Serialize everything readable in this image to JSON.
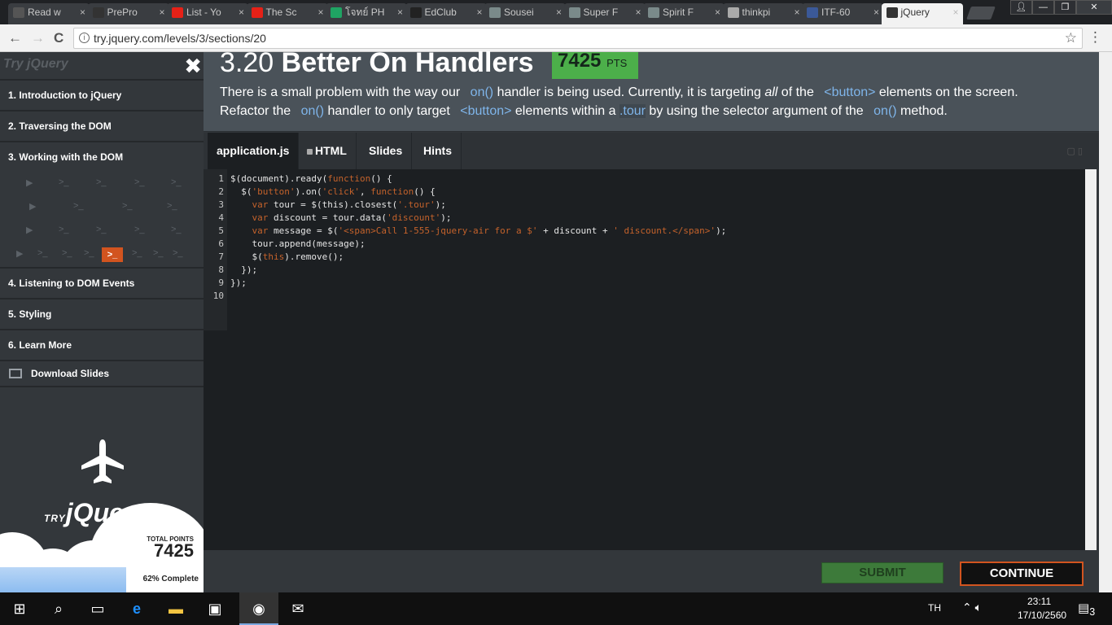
{
  "browser": {
    "tabs": [
      {
        "label": "Read w",
        "color": "#555"
      },
      {
        "label": "PrePro",
        "color": "#333"
      },
      {
        "label": "List - Yo",
        "color": "#e62117"
      },
      {
        "label": "The Sc",
        "color": "#e62117"
      },
      {
        "label": "โจทย์ PH",
        "color": "#1fa463"
      },
      {
        "label": "EdClub",
        "color": "#222"
      },
      {
        "label": "Sousei",
        "color": "#7a8a8a"
      },
      {
        "label": "Super F",
        "color": "#7a8a8a"
      },
      {
        "label": "Spirit F",
        "color": "#7a8a8a"
      },
      {
        "label": "thinkpi",
        "color": "#aaa"
      },
      {
        "label": "ITF-60",
        "color": "#3b5998"
      },
      {
        "label": "jQuery",
        "color": "#333"
      }
    ],
    "tab_close": "×",
    "url": "try.jquery.com/levels/3/sections/20",
    "star": "☆",
    "menu": "⋮",
    "back": "←",
    "forward": "→",
    "reload": "C",
    "info": "i"
  },
  "sidebar": {
    "title": "Try jQuery",
    "close": "✖",
    "sections": [
      "1. Introduction to jQuery",
      "2. Traversing the DOM",
      "3. Working with the DOM",
      "4. Listening to DOM Events",
      "5. Styling",
      "6. Learn More"
    ],
    "download": "Download Slides",
    "logo_try": "TRY",
    "logo_jquery": "jQuery",
    "total_points_label": "TOTAL POINTS",
    "total_points": "7425",
    "progress_text": "62% Complete",
    "progress_fraction": 0.62
  },
  "lesson": {
    "number": "3.20",
    "title": "Better On Handlers",
    "points": "7425",
    "points_unit": "PTS",
    "desc": {
      "p1": "There is a small problem with the way our ",
      "c1": "on()",
      "p2": " handler is being used. Currently, it is targeting ",
      "em": "all",
      "p3": " of the ",
      "c2": "<button>",
      "p4": " elements on the screen.",
      "p5": "Refactor the ",
      "c3": "on()",
      "p6": " handler to only target ",
      "c4": "<button>",
      "p7": " elements within a ",
      "c5": ".tour",
      "p8": " by using the selector argument of the ",
      "c6": "on()",
      "p9": " method."
    }
  },
  "editor": {
    "tabs": [
      "application.js",
      "HTML",
      "Slides",
      "Hints"
    ],
    "lines": [
      [
        [
          "pl",
          "$(document).ready("
        ],
        [
          "kw",
          "function"
        ],
        [
          "pl",
          "() {"
        ]
      ],
      [
        [
          "pl",
          "  $("
        ],
        [
          "st",
          "'button'"
        ],
        [
          "pl",
          ").on("
        ],
        [
          "st",
          "'click'"
        ],
        [
          "pl",
          ", "
        ],
        [
          "kw",
          "function"
        ],
        [
          "pl",
          "() {"
        ]
      ],
      [
        [
          "kw",
          "    var"
        ],
        [
          "pl",
          " tour = $(this).closest("
        ],
        [
          "st",
          "'.tour'"
        ],
        [
          "pl",
          ");"
        ]
      ],
      [
        [
          "kw",
          "    var"
        ],
        [
          "pl",
          " discount = tour.data("
        ],
        [
          "st",
          "'discount'"
        ],
        [
          "pl",
          ");"
        ]
      ],
      [
        [
          "kw",
          "    var"
        ],
        [
          "pl",
          " message = $("
        ],
        [
          "st",
          "'<span>Call 1-555-jquery-air for a $'"
        ],
        [
          "pl",
          " + discount + "
        ],
        [
          "st",
          "' discount.</span>'"
        ],
        [
          "pl",
          ");"
        ]
      ],
      [
        [
          "pl",
          "    tour.append(message);"
        ]
      ],
      [
        [
          "pl",
          "    $("
        ],
        [
          "kw",
          "this"
        ],
        [
          "pl",
          ").remove();"
        ]
      ],
      [
        [
          "pl",
          "  });"
        ]
      ],
      [
        [
          "pl",
          "});"
        ]
      ],
      [
        [
          "pl",
          ""
        ]
      ]
    ]
  },
  "buttons": {
    "submit": "SUBMIT",
    "continue": "CONTINUE"
  },
  "taskbar": {
    "lang": "TH",
    "time": "23:11",
    "date": "17/10/2560",
    "notifications": "3"
  }
}
